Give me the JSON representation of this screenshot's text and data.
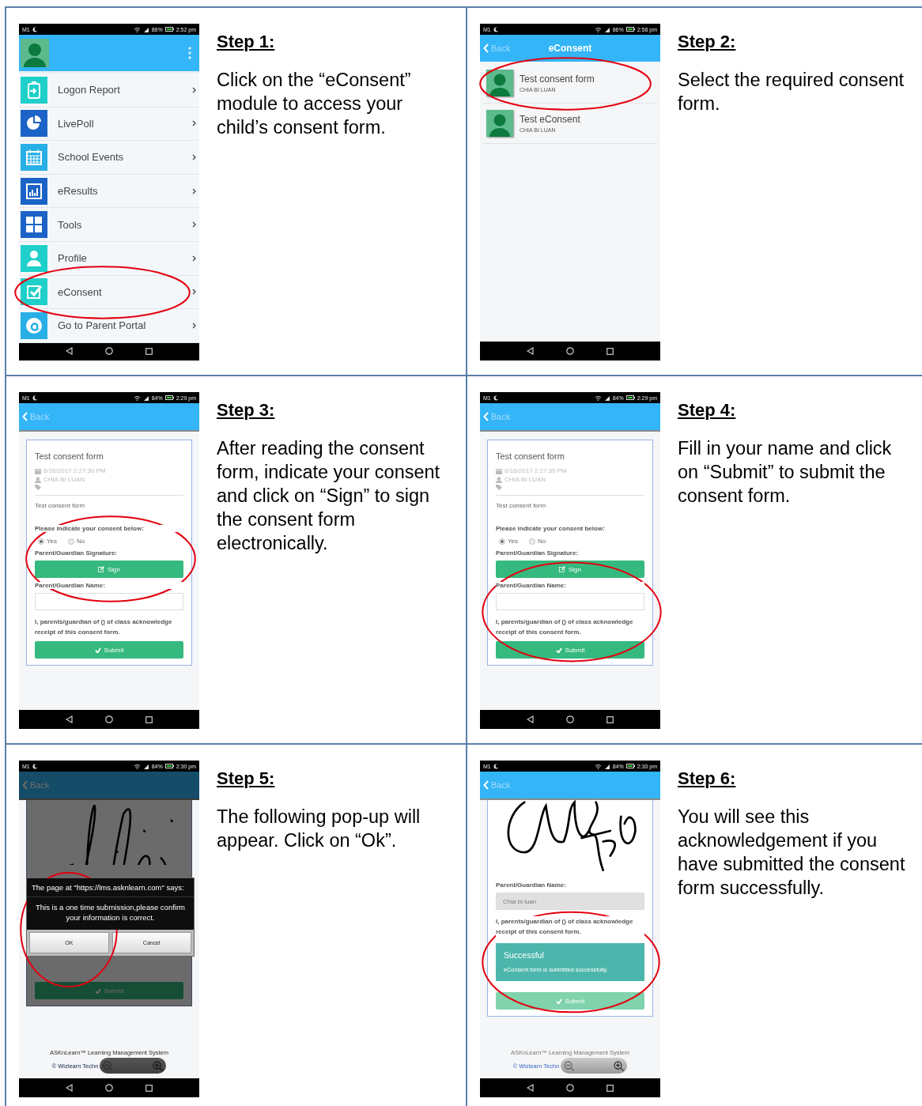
{
  "steps": [
    {
      "title": "Step 1:",
      "instructions": "Click on the “eConsent” module to access your child’s consent form.",
      "screen": {
        "kind": "menu",
        "status": {
          "carrier": "M1",
          "battery": "86%",
          "time": "2:52 pm"
        },
        "items": [
          {
            "label": "Logon Report",
            "color": "#1fcfc9",
            "highlighted": false
          },
          {
            "label": "LivePoll",
            "color": "#1b63c6",
            "highlighted": false
          },
          {
            "label": "School Events",
            "color": "#27afe6",
            "highlighted": false
          },
          {
            "label": "eResults",
            "color": "#1b63c6",
            "highlighted": false
          },
          {
            "label": "Tools",
            "color": "#1b63c6",
            "highlighted": false
          },
          {
            "label": "Profile",
            "color": "#1fcfc9",
            "highlighted": false
          },
          {
            "label": "eConsent",
            "color": "#1fcfc9",
            "highlighted": true
          },
          {
            "label": "Go to Parent Portal",
            "color": "#27afe6",
            "highlighted": false
          }
        ]
      }
    },
    {
      "title": "Step 2:",
      "instructions": "Select the required consent form.",
      "screen": {
        "kind": "list",
        "status": {
          "carrier": "M1",
          "battery": "86%",
          "time": "2:58 pm"
        },
        "back": "Back",
        "heading": "eConsent",
        "items": [
          {
            "title": "Test consent form",
            "subtitle": "CHIA BI LUAN",
            "highlighted": true
          },
          {
            "title": "Test eConsent",
            "subtitle": "CHIA BI LUAN",
            "highlighted": false
          }
        ]
      }
    },
    {
      "title": "Step 3:",
      "instructions": "After reading the consent form, indicate your consent and click on “Sign” to sign the consent form electronically.",
      "screen": {
        "kind": "form",
        "status": {
          "carrier": "M1",
          "battery": "84%",
          "time": "2:29 pm"
        },
        "back": "Back",
        "highlights": {
          "consent": true,
          "submission": false
        },
        "form": {
          "title": "Test consent form",
          "date": "6/16/2017 2:27:30 PM",
          "author": "CHIA BI LUAN",
          "description": "Test consent form",
          "prompt": "Please indicate your consent below:",
          "options": [
            {
              "label": "Yes",
              "selected": true
            },
            {
              "label": "No",
              "selected": false
            }
          ],
          "signature_label": "Parent/Guardian Signature:",
          "sign_button": "Sign",
          "name_label": "Parent/Guardian Name:",
          "acknowledgement": "I, parents/guardian of () of class acknowledge receipt of this consent form.",
          "submit_button": "Submit"
        }
      }
    },
    {
      "title": "Step 4:",
      "instructions": "Fill in your name and click on “Submit” to submit the consent form.",
      "screen": {
        "kind": "form",
        "status": {
          "carrier": "M1",
          "battery": "84%",
          "time": "2:29 pm"
        },
        "back": "Back",
        "highlights": {
          "consent": false,
          "submission": true
        },
        "form": {
          "title": "Test consent form",
          "date": "6/16/2017 2:27:30 PM",
          "author": "CHIA BI LUAN",
          "description": "Test consent form",
          "prompt": "Please indicate your consent below:",
          "options": [
            {
              "label": "Yes",
              "selected": true
            },
            {
              "label": "No",
              "selected": false
            }
          ],
          "signature_label": "Parent/Guardian Signature:",
          "sign_button": "Sign",
          "name_label": "Parent/Guardian Name:",
          "acknowledgement": "I, parents/guardian of () of class acknowledge receipt of this consent form.",
          "submit_button": "Submit"
        }
      }
    },
    {
      "title": "Step 5:",
      "instructions": "The following pop-up will appear. Click on “Ok”.",
      "screen": {
        "kind": "dialog",
        "status": {
          "carrier": "M1",
          "battery": "84%",
          "time": "2:30 pm"
        },
        "back": "Back",
        "submit_button": "Submit",
        "footer": {
          "product": "ASKnLearn™ Learning Management System",
          "copyright": "© Wizlearn Techn"
        },
        "dialog": {
          "heading": "The page at \"https://lms.asknlearn.com\" says:",
          "message": "This is a one time submission,please confirm your information is correct.",
          "buttons": [
            {
              "label": "OK",
              "highlighted": true
            },
            {
              "label": "Cancel",
              "highlighted": false
            }
          ]
        }
      }
    },
    {
      "title": "Step 6:",
      "instructions": "You will see this acknowledgement if you have submitted the consent form successfully.",
      "screen": {
        "kind": "success",
        "status": {
          "carrier": "M1",
          "battery": "84%",
          "time": "2:30 pm"
        },
        "back": "Back",
        "name_label": "Parent/Guardian Name:",
        "name_value": "Chia bi luan",
        "acknowledgement": "I, parents/guardian of () of class acknowledge receipt of this consent form.",
        "alert": {
          "title": "Successful",
          "message": "eConsent form is submitted successfully.",
          "highlighted": true
        },
        "submit_button": "Submit",
        "footer": {
          "product": "ASKnLearn™ Learning Management System",
          "copyright": "© Wizlearn Techn"
        }
      }
    }
  ]
}
